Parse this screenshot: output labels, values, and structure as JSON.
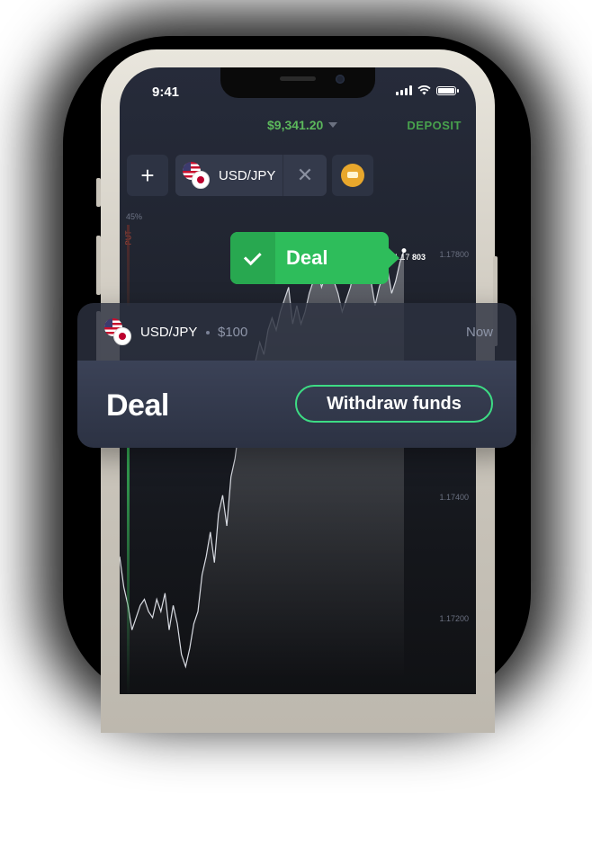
{
  "status_bar": {
    "time": "9:41"
  },
  "header": {
    "balance": "$9,341.20",
    "deposit_label": "DEPOSIT"
  },
  "tabs": {
    "add_label": "+",
    "active_pair": "USD/JPY",
    "close_label": "✕"
  },
  "chart": {
    "percent_label": "45%",
    "put_label": "PUT",
    "current_price_prefix": "1.17",
    "current_price_bold": "803",
    "price_levels": [
      "1.17800",
      "1.17400",
      "1.17200"
    ]
  },
  "deal_popup": {
    "label": "Deal"
  },
  "notification": {
    "pair": "USD/JPY",
    "amount": "$100",
    "time": "Now",
    "title": "Deal",
    "withdraw_label": "Withdraw funds"
  },
  "colors": {
    "accent_green": "#2ebd5b",
    "balance_green": "#5cb85c",
    "coin_gold": "#e8a72c",
    "put_red": "#e0533a"
  },
  "chart_data": {
    "type": "line",
    "y_ticks": [
      "1.17800",
      "1.17400",
      "1.17200"
    ],
    "x": [
      0,
      1,
      2,
      3,
      4,
      5,
      6,
      7,
      8,
      9,
      10,
      11,
      12,
      13,
      14,
      15,
      16,
      17,
      18,
      19,
      20,
      21,
      22,
      23,
      24,
      25,
      26,
      27,
      28,
      29,
      30,
      31,
      32,
      33,
      34,
      35,
      36,
      37,
      38,
      39,
      40,
      41,
      42,
      43,
      44,
      45,
      46,
      47,
      48,
      49,
      50,
      51,
      52,
      53,
      54,
      55,
      56,
      57,
      58,
      59,
      60,
      61,
      62,
      63,
      64,
      65,
      66,
      67,
      68,
      69
    ],
    "values": [
      1.1734,
      1.1729,
      1.1726,
      1.1722,
      1.1724,
      1.1726,
      1.1727,
      1.1725,
      1.1724,
      1.1727,
      1.1725,
      1.1728,
      1.1722,
      1.1726,
      1.1723,
      1.1718,
      1.1716,
      1.1719,
      1.1723,
      1.1725,
      1.1731,
      1.1734,
      1.1738,
      1.1733,
      1.1741,
      1.1744,
      1.1739,
      1.1747,
      1.175,
      1.1755,
      1.176,
      1.1758,
      1.1762,
      1.1766,
      1.1769,
      1.1767,
      1.1771,
      1.1773,
      1.1771,
      1.1774,
      1.1776,
      1.1778,
      1.1772,
      1.1775,
      1.1772,
      1.1774,
      1.1777,
      1.1779,
      1.1781,
      1.1778,
      1.178,
      1.1782,
      1.1779,
      1.1777,
      1.1774,
      1.1776,
      1.1778,
      1.1781,
      1.1779,
      1.1784,
      1.1783,
      1.1779,
      1.1775,
      1.1778,
      1.178,
      1.1781,
      1.1777,
      1.1779,
      1.1782,
      1.1784
    ]
  }
}
